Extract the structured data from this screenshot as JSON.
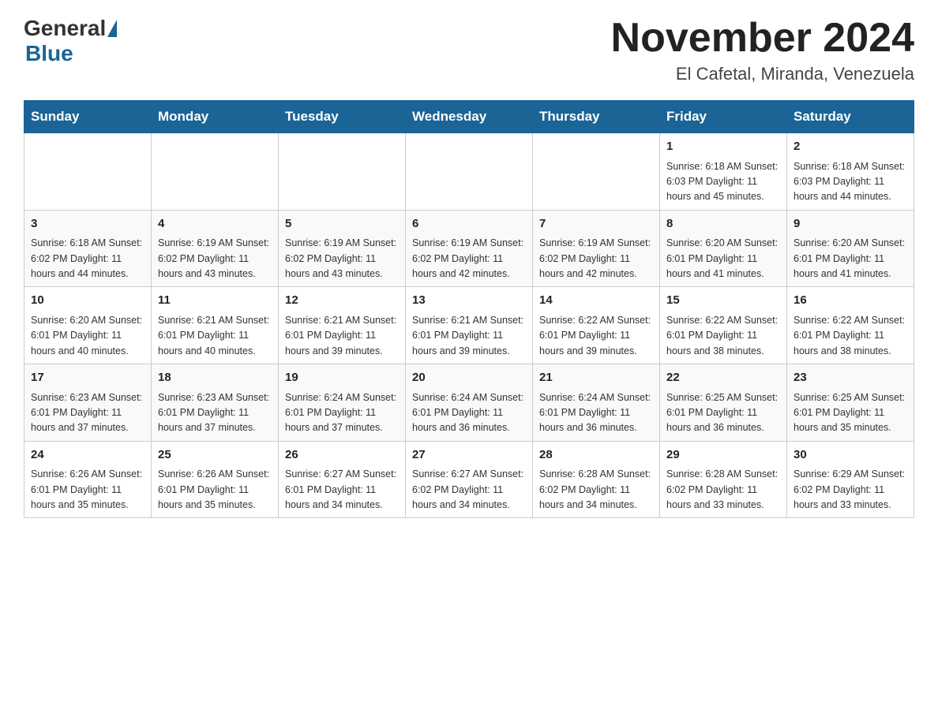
{
  "header": {
    "logo_general": "General",
    "logo_blue": "Blue",
    "title": "November 2024",
    "subtitle": "El Cafetal, Miranda, Venezuela"
  },
  "weekdays": [
    "Sunday",
    "Monday",
    "Tuesday",
    "Wednesday",
    "Thursday",
    "Friday",
    "Saturday"
  ],
  "weeks": [
    [
      {
        "day": "",
        "info": ""
      },
      {
        "day": "",
        "info": ""
      },
      {
        "day": "",
        "info": ""
      },
      {
        "day": "",
        "info": ""
      },
      {
        "day": "",
        "info": ""
      },
      {
        "day": "1",
        "info": "Sunrise: 6:18 AM\nSunset: 6:03 PM\nDaylight: 11 hours and 45 minutes."
      },
      {
        "day": "2",
        "info": "Sunrise: 6:18 AM\nSunset: 6:03 PM\nDaylight: 11 hours and 44 minutes."
      }
    ],
    [
      {
        "day": "3",
        "info": "Sunrise: 6:18 AM\nSunset: 6:02 PM\nDaylight: 11 hours and 44 minutes."
      },
      {
        "day": "4",
        "info": "Sunrise: 6:19 AM\nSunset: 6:02 PM\nDaylight: 11 hours and 43 minutes."
      },
      {
        "day": "5",
        "info": "Sunrise: 6:19 AM\nSunset: 6:02 PM\nDaylight: 11 hours and 43 minutes."
      },
      {
        "day": "6",
        "info": "Sunrise: 6:19 AM\nSunset: 6:02 PM\nDaylight: 11 hours and 42 minutes."
      },
      {
        "day": "7",
        "info": "Sunrise: 6:19 AM\nSunset: 6:02 PM\nDaylight: 11 hours and 42 minutes."
      },
      {
        "day": "8",
        "info": "Sunrise: 6:20 AM\nSunset: 6:01 PM\nDaylight: 11 hours and 41 minutes."
      },
      {
        "day": "9",
        "info": "Sunrise: 6:20 AM\nSunset: 6:01 PM\nDaylight: 11 hours and 41 minutes."
      }
    ],
    [
      {
        "day": "10",
        "info": "Sunrise: 6:20 AM\nSunset: 6:01 PM\nDaylight: 11 hours and 40 minutes."
      },
      {
        "day": "11",
        "info": "Sunrise: 6:21 AM\nSunset: 6:01 PM\nDaylight: 11 hours and 40 minutes."
      },
      {
        "day": "12",
        "info": "Sunrise: 6:21 AM\nSunset: 6:01 PM\nDaylight: 11 hours and 39 minutes."
      },
      {
        "day": "13",
        "info": "Sunrise: 6:21 AM\nSunset: 6:01 PM\nDaylight: 11 hours and 39 minutes."
      },
      {
        "day": "14",
        "info": "Sunrise: 6:22 AM\nSunset: 6:01 PM\nDaylight: 11 hours and 39 minutes."
      },
      {
        "day": "15",
        "info": "Sunrise: 6:22 AM\nSunset: 6:01 PM\nDaylight: 11 hours and 38 minutes."
      },
      {
        "day": "16",
        "info": "Sunrise: 6:22 AM\nSunset: 6:01 PM\nDaylight: 11 hours and 38 minutes."
      }
    ],
    [
      {
        "day": "17",
        "info": "Sunrise: 6:23 AM\nSunset: 6:01 PM\nDaylight: 11 hours and 37 minutes."
      },
      {
        "day": "18",
        "info": "Sunrise: 6:23 AM\nSunset: 6:01 PM\nDaylight: 11 hours and 37 minutes."
      },
      {
        "day": "19",
        "info": "Sunrise: 6:24 AM\nSunset: 6:01 PM\nDaylight: 11 hours and 37 minutes."
      },
      {
        "day": "20",
        "info": "Sunrise: 6:24 AM\nSunset: 6:01 PM\nDaylight: 11 hours and 36 minutes."
      },
      {
        "day": "21",
        "info": "Sunrise: 6:24 AM\nSunset: 6:01 PM\nDaylight: 11 hours and 36 minutes."
      },
      {
        "day": "22",
        "info": "Sunrise: 6:25 AM\nSunset: 6:01 PM\nDaylight: 11 hours and 36 minutes."
      },
      {
        "day": "23",
        "info": "Sunrise: 6:25 AM\nSunset: 6:01 PM\nDaylight: 11 hours and 35 minutes."
      }
    ],
    [
      {
        "day": "24",
        "info": "Sunrise: 6:26 AM\nSunset: 6:01 PM\nDaylight: 11 hours and 35 minutes."
      },
      {
        "day": "25",
        "info": "Sunrise: 6:26 AM\nSunset: 6:01 PM\nDaylight: 11 hours and 35 minutes."
      },
      {
        "day": "26",
        "info": "Sunrise: 6:27 AM\nSunset: 6:01 PM\nDaylight: 11 hours and 34 minutes."
      },
      {
        "day": "27",
        "info": "Sunrise: 6:27 AM\nSunset: 6:02 PM\nDaylight: 11 hours and 34 minutes."
      },
      {
        "day": "28",
        "info": "Sunrise: 6:28 AM\nSunset: 6:02 PM\nDaylight: 11 hours and 34 minutes."
      },
      {
        "day": "29",
        "info": "Sunrise: 6:28 AM\nSunset: 6:02 PM\nDaylight: 11 hours and 33 minutes."
      },
      {
        "day": "30",
        "info": "Sunrise: 6:29 AM\nSunset: 6:02 PM\nDaylight: 11 hours and 33 minutes."
      }
    ]
  ]
}
